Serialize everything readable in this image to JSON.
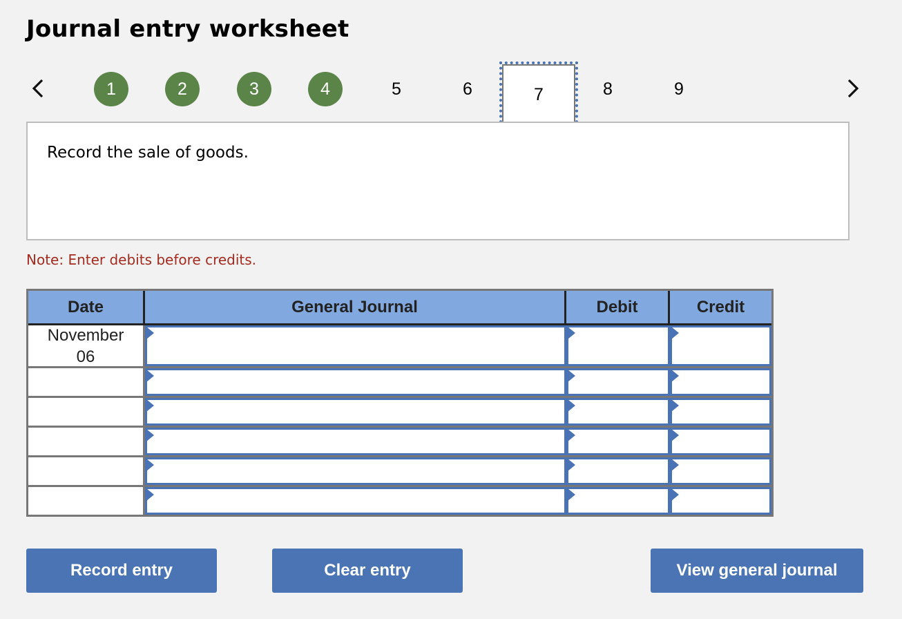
{
  "header": {
    "title": "Journal entry worksheet"
  },
  "steps": {
    "prev_icon": "chevron-left-icon",
    "next_icon": "chevron-right-icon",
    "items": [
      {
        "label": "1",
        "state": "done"
      },
      {
        "label": "2",
        "state": "done"
      },
      {
        "label": "3",
        "state": "done"
      },
      {
        "label": "4",
        "state": "done"
      },
      {
        "label": "5",
        "state": "pending"
      },
      {
        "label": "6",
        "state": "pending"
      },
      {
        "label": "7",
        "state": "current"
      },
      {
        "label": "8",
        "state": "pending"
      },
      {
        "label": "9",
        "state": "pending"
      }
    ]
  },
  "prompt": {
    "text": "Record the sale of goods."
  },
  "note": {
    "text": "Note: Enter debits before credits."
  },
  "journal": {
    "columns": {
      "date": "Date",
      "account": "General Journal",
      "debit": "Debit",
      "credit": "Credit"
    },
    "rows": [
      {
        "date_line1": "November",
        "date_line2": "06",
        "account": "",
        "debit": "",
        "credit": ""
      },
      {
        "date_line1": "",
        "date_line2": "",
        "account": "",
        "debit": "",
        "credit": ""
      },
      {
        "date_line1": "",
        "date_line2": "",
        "account": "",
        "debit": "",
        "credit": ""
      },
      {
        "date_line1": "",
        "date_line2": "",
        "account": "",
        "debit": "",
        "credit": ""
      },
      {
        "date_line1": "",
        "date_line2": "",
        "account": "",
        "debit": "",
        "credit": ""
      },
      {
        "date_line1": "",
        "date_line2": "",
        "account": "",
        "debit": "",
        "credit": ""
      }
    ]
  },
  "buttons": {
    "record": "Record entry",
    "clear": "Clear entry",
    "view": "View general journal"
  },
  "colors": {
    "completed_step": "#5b8449",
    "header_fill": "#82a9df",
    "accent_blue": "#4a74b4",
    "note_red": "#a52a1f"
  }
}
